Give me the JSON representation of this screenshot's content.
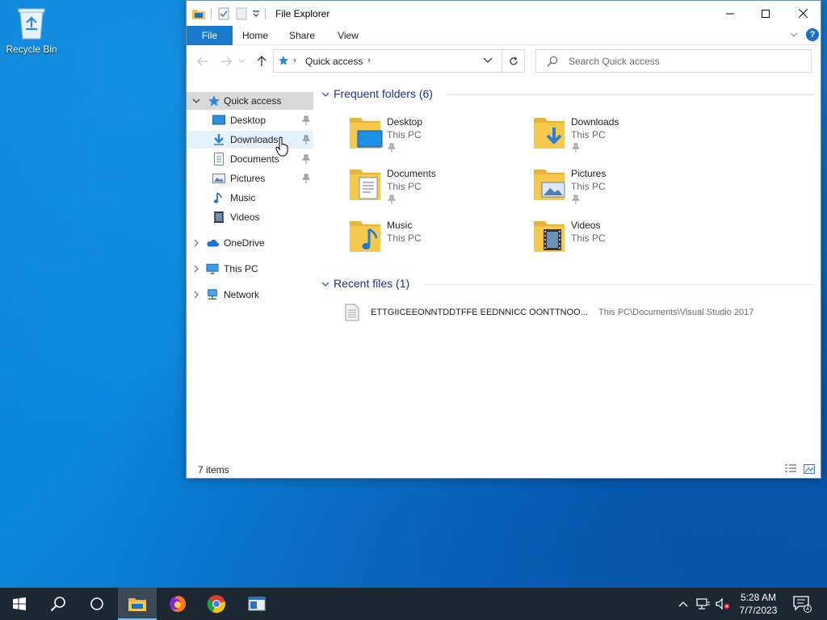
{
  "desktop": {
    "recycle_bin_label": "Recycle Bin"
  },
  "window": {
    "title": "File Explorer",
    "ribbon_tabs": [
      "File",
      "Home",
      "Share",
      "View"
    ],
    "help_glyph": "?",
    "address": {
      "crumb": "Quick access",
      "sep": "›"
    },
    "search": {
      "placeholder": "Search Quick access"
    }
  },
  "nav_pane": {
    "quick_access": "Quick access",
    "items": [
      {
        "label": "Desktop",
        "icon": "desktop-icon",
        "pinned": true
      },
      {
        "label": "Downloads",
        "icon": "downloads-icon",
        "pinned": true
      },
      {
        "label": "Documents",
        "icon": "documents-icon",
        "pinned": true
      },
      {
        "label": "Pictures",
        "icon": "pictures-icon",
        "pinned": true
      },
      {
        "label": "Music",
        "icon": "music-icon",
        "pinned": false
      },
      {
        "label": "Videos",
        "icon": "videos-icon",
        "pinned": false
      }
    ],
    "roots": [
      {
        "label": "OneDrive",
        "icon": "onedrive-icon"
      },
      {
        "label": "This PC",
        "icon": "this-pc-icon"
      },
      {
        "label": "Network",
        "icon": "network-icon"
      }
    ]
  },
  "content": {
    "frequent_title": "Frequent folders (6)",
    "folders": [
      {
        "name": "Desktop",
        "location": "This PC",
        "pinned": true
      },
      {
        "name": "Downloads",
        "location": "This PC",
        "pinned": true
      },
      {
        "name": "Documents",
        "location": "This PC",
        "pinned": true
      },
      {
        "name": "Pictures",
        "location": "This PC",
        "pinned": true
      },
      {
        "name": "Music",
        "location": "This PC",
        "pinned": false
      },
      {
        "name": "Videos",
        "location": "This PC",
        "pinned": false
      }
    ],
    "recent_title": "Recent files (1)",
    "recent_files": [
      {
        "name": "ETTGIICEEONNTDDTFFE EEDNNICC OONTTNOO...",
        "path": "This PC\\Documents\\Visual Studio 2017"
      }
    ]
  },
  "status": {
    "items_count": "7 items"
  },
  "taskbar": {
    "time": "5:28 AM",
    "date": "7/7/2023",
    "notification_count": "1"
  },
  "colors": {
    "accent": "#1979ca",
    "group_title": "#1e3287",
    "taskbar": "#1c2732",
    "folder": "#f6c84c"
  }
}
